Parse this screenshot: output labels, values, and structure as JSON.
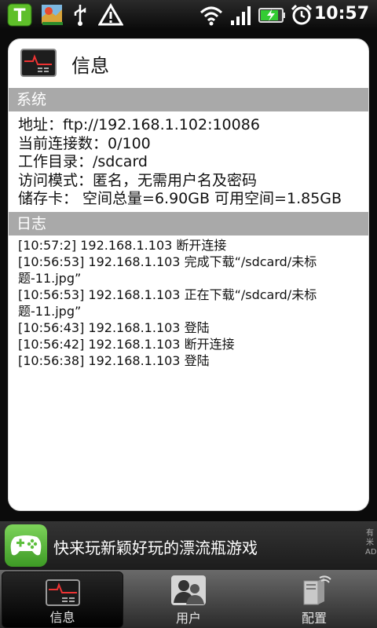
{
  "status_bar": {
    "time": "10:57"
  },
  "header": {
    "title": "信息"
  },
  "system": {
    "section_label": "系统",
    "lines": [
      "地址：ftp://192.168.1.102:10086",
      "当前连接数：0/100",
      "工作目录：/sdcard",
      "访问模式：匿名，无需用户名及密码",
      "储存卡： 空间总量=6.90GB  可用空间=1.85GB"
    ]
  },
  "log": {
    "section_label": "日志",
    "lines": [
      "[10:57:2]  192.168.1.103  断开连接",
      "[10:56:53]  192.168.1.103  完成下载“/sdcard/未标题-11.jpg”",
      "[10:56:53]  192.168.1.103  正在下载“/sdcard/未标题-11.jpg”",
      "[10:56:43]  192.168.1.103  登陆",
      "[10:56:42]  192.168.1.103  断开连接",
      "[10:56:38]  192.168.1.103  登陆"
    ]
  },
  "ad": {
    "text": "快来玩新颖好玩的漂流瓶游戏",
    "side_label": "有米AD"
  },
  "tabs": [
    {
      "label": "信息",
      "icon": "monitor-icon",
      "active": true
    },
    {
      "label": "用户",
      "icon": "users-icon",
      "active": false
    },
    {
      "label": "配置",
      "icon": "server-config-icon",
      "active": false
    }
  ],
  "colors": {
    "section_bar": "#a9a9a9",
    "ad_icon": "#5cbf3c",
    "battery": "#33cc33"
  }
}
